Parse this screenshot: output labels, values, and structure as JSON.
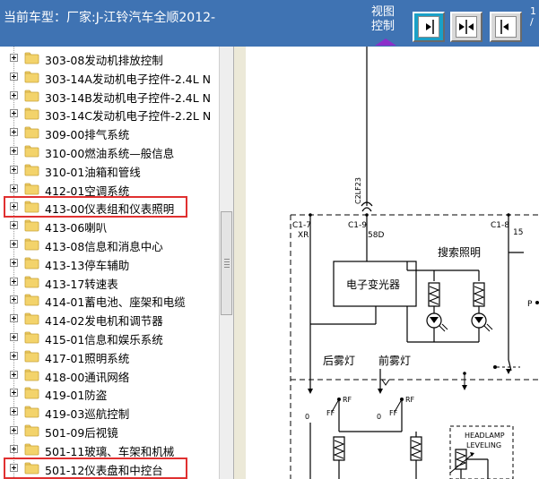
{
  "header": {
    "car_model_text": "当前车型：厂家:J-江铃汽车全顺2012-",
    "view_control_line1": "视图",
    "view_control_line2": "控制",
    "right_cut_text_line1": "1",
    "right_cut_text_line2": "/"
  },
  "view_buttons": [
    {
      "name": "view-right-button",
      "icon": "arrow-right-icon"
    },
    {
      "name": "view-center-button",
      "icon": "arrows-inward-icon"
    },
    {
      "name": "view-left-button",
      "icon": "arrow-left-icon"
    }
  ],
  "tree": {
    "items": [
      {
        "label": "303-08发动机排放控制"
      },
      {
        "label": "303-14A发动机电子控件-2.4L N"
      },
      {
        "label": "303-14B发动机电子控件-2.4L N"
      },
      {
        "label": "303-14C发动机电子控件-2.2L N"
      },
      {
        "label": "309-00排气系统"
      },
      {
        "label": "310-00燃油系统—般信息"
      },
      {
        "label": "310-01油箱和管线"
      },
      {
        "label": "412-01空调系统"
      },
      {
        "label": "413-00仪表组和仪表照明",
        "highlighted": true
      },
      {
        "label": "413-06喇叭"
      },
      {
        "label": "413-08信息和消息中心"
      },
      {
        "label": "413-13停车辅助"
      },
      {
        "label": "413-17转速表"
      },
      {
        "label": "414-01蓄电池、座架和电缆"
      },
      {
        "label": "414-02发电机和调节器"
      },
      {
        "label": "415-01信息和娱乐系统"
      },
      {
        "label": "417-01照明系统"
      },
      {
        "label": "418-00通讯网络"
      },
      {
        "label": "419-01防盗"
      },
      {
        "label": "419-03巡航控制"
      },
      {
        "label": "501-09后视镜"
      },
      {
        "label": "501-11玻璃、车架和机械"
      },
      {
        "label": "501-12仪表盘和中控台",
        "highlighted": true
      }
    ]
  },
  "diagram": {
    "connector_top": "C2LF23",
    "pin_c17": "C1-7",
    "pin_xr": "XR",
    "pin_c19": "C1-9",
    "pin_58d": "58D",
    "pin_c18": "C1-8",
    "pin_15": "15",
    "search_light": "搜索照明",
    "electronic_dimmer": "电子变光器",
    "rear_fog": "后雾灯",
    "front_fog": "前雾灯",
    "p_label": "P",
    "rf1": "RF",
    "ff1": "FF",
    "rf2": "RF",
    "ff2": "FF",
    "zero1": "0",
    "zero2": "0",
    "headlamp1": "HEADLAMP",
    "headlamp2": "LEVELING"
  },
  "colors": {
    "header_bg": "#3f73b3",
    "highlight_border": "#e03030",
    "active_button": "#1aa0c7",
    "folder": "#f3d36b"
  }
}
